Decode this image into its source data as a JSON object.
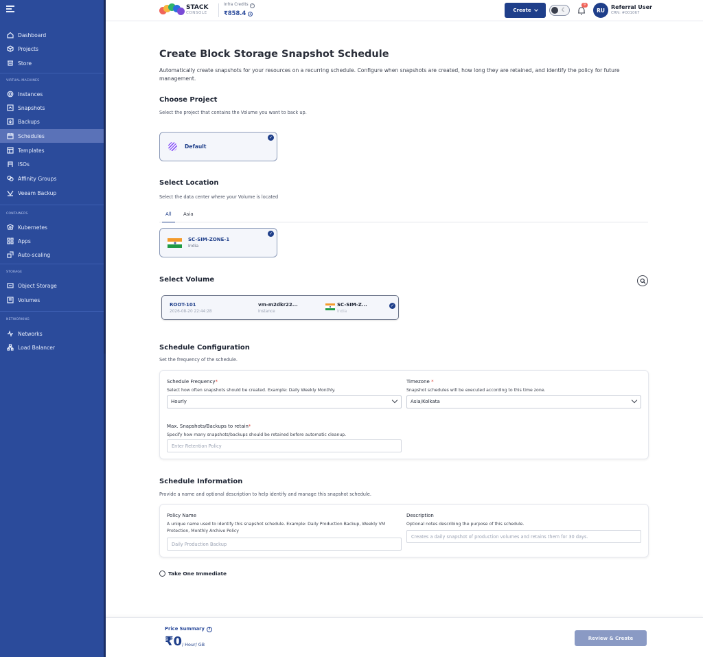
{
  "topbar": {
    "logo_main": "STACK",
    "logo_sub": "CONSOLE",
    "credits_label": "Infra Credits",
    "credits_value": "₹858.4",
    "create_label": "Create",
    "notification_count": "9",
    "avatar_initials": "RU",
    "user_name": "Referral User",
    "user_cin": "CRN: #001067"
  },
  "sidebar": {
    "top_items": [
      {
        "label": "Dashboard",
        "icon": "home-icon"
      },
      {
        "label": "Projects",
        "icon": "box-icon"
      },
      {
        "label": "Store",
        "icon": "store-icon"
      }
    ],
    "sections": [
      {
        "title": "VIRTUAL MACHINES",
        "items": [
          {
            "label": "Instances",
            "icon": "gear-icon"
          },
          {
            "label": "Snapshots",
            "icon": "snapshot-icon"
          },
          {
            "label": "Backups",
            "icon": "backup-icon"
          },
          {
            "label": "Schedules",
            "icon": "calendar-icon",
            "active": true
          },
          {
            "label": "Templates",
            "icon": "template-icon"
          },
          {
            "label": "ISOs",
            "icon": "iso-icon"
          },
          {
            "label": "Affinity Groups",
            "icon": "affinity-icon"
          },
          {
            "label": "Veeam Backup",
            "icon": "veeam-icon"
          }
        ]
      },
      {
        "title": "CONTAINERS",
        "items": [
          {
            "label": "Kubernetes",
            "icon": "kubernetes-icon"
          },
          {
            "label": "Apps",
            "icon": "apps-icon"
          },
          {
            "label": "Auto-scaling",
            "icon": "autoscale-icon"
          }
        ]
      },
      {
        "title": "STORAGE",
        "items": [
          {
            "label": "Object Storage",
            "icon": "object-storage-icon"
          },
          {
            "label": "Volumes",
            "icon": "volume-icon"
          }
        ]
      },
      {
        "title": "NETWORKING",
        "items": [
          {
            "label": "Networks",
            "icon": "network-icon"
          },
          {
            "label": "Load Balancer",
            "icon": "load-balancer-icon"
          }
        ]
      }
    ]
  },
  "page": {
    "title": "Create Block Storage Snapshot Schedule",
    "description": "Automatically create snapshots for your resources on a recurring schedule. Configure when snapshots are created, how long they are retained, and identify the policy for future management."
  },
  "project": {
    "title": "Choose Project",
    "description": "Select the project that contains the Volume you want to back up.",
    "selected_name": "Default"
  },
  "location": {
    "title": "Select Location",
    "description": "Select the data center where your Volume is located",
    "tabs": [
      "All",
      "Asia"
    ],
    "zone": "SC-SIM-ZONE-1",
    "country": "India"
  },
  "volume": {
    "title": "Select Volume",
    "name": "ROOT-101",
    "created": "2026-08-20 22:44:28",
    "instance": "vm-m2dkr22...",
    "instance_label": "Instance",
    "zone": "SC-SIM-Z...",
    "country": "India"
  },
  "schedule_config": {
    "title": "Schedule Configuration",
    "description": "Set the frequency of the schedule.",
    "frequency_label": "Schedule Frequency",
    "frequency_help": "Select how often snapshots should be created. Example: Daily Weekly Monthly.",
    "frequency_value": "Hourly",
    "timezone_label": "Timezone ",
    "timezone_help": "Snapshot schedules will be executed according to this time zone.",
    "timezone_value": "Asia/Kolkata",
    "retain_label": "Max. Snapshots/Backups to retain",
    "retain_help": "Specify how many snapshots/backups should be retained before automatic cleanup.",
    "retain_placeholder": "Enter Retention Policy",
    "required_mark": "*"
  },
  "schedule_info": {
    "title": "Schedule Information",
    "description": "Provide a name and optional description to help identify and manage this snapshot schedule.",
    "policy_label": "Policy Name",
    "policy_help": "A unique name used to identify this snapshot schedule. Example: Daily Production Backup, Weekly VM Protection, Monthly Archive Policy",
    "policy_placeholder": "Daily Production Backup",
    "desc_label": "Description",
    "desc_help": "Optional notes describing the purpose of this schedule.",
    "desc_placeholder": "Creates a daily snapshot of production volumes and retains them for 30 days."
  },
  "immediate": {
    "label": "Take One Immediate"
  },
  "footer": {
    "price_label": "Price Summary",
    "price_value": "₹0",
    "price_unit": "/ Hour/ GB",
    "review_label": "Review & Create"
  },
  "colors": {
    "sidebar_bg": "#2b4b9b",
    "primary": "#1f3f8a",
    "active_nav": "#5a72b8"
  }
}
